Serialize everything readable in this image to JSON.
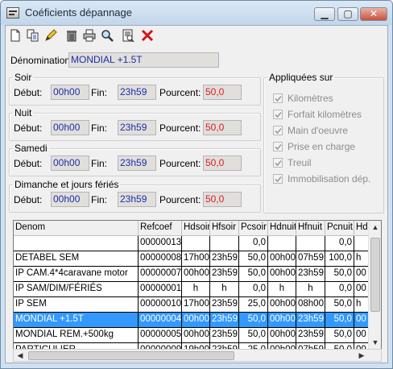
{
  "window": {
    "title": "Coéficients dépannage"
  },
  "toolbar": {
    "buttons": [
      {
        "icon": "new-icon"
      },
      {
        "icon": "copy-icon"
      },
      {
        "icon": "edit-icon"
      },
      {
        "icon": "delete-icon"
      },
      {
        "icon": "print-icon"
      },
      {
        "icon": "search-icon"
      },
      {
        "icon": "report-icon"
      },
      {
        "icon": "close-icon"
      }
    ]
  },
  "form": {
    "denomination_label": "Dénomination:",
    "denomination_value": "MONDIAL +1.5T",
    "debut_label": "Début:",
    "fin_label": "Fin:",
    "pourcent_label": "Pourcent:",
    "groups": [
      {
        "title": "Soir",
        "debut": "00h00",
        "fin": "23h59",
        "pourcent": "50,0"
      },
      {
        "title": "Nuit",
        "debut": "00h00",
        "fin": "23h59",
        "pourcent": "50,0"
      },
      {
        "title": "Samedi",
        "debut": "00h00",
        "fin": "23h59",
        "pourcent": "50,0"
      },
      {
        "title": "Dimanche et jours fériés",
        "debut": "00h00",
        "fin": "23h59",
        "pourcent": "50,0"
      }
    ],
    "appliquees": {
      "title": "Appliquées sur",
      "items": [
        {
          "label": "Kilomètres",
          "checked": true
        },
        {
          "label": "Forfait kilomètres",
          "checked": true
        },
        {
          "label": "Main d'oeuvre",
          "checked": true
        },
        {
          "label": "Prise en charge",
          "checked": true
        },
        {
          "label": "Treuil",
          "checked": true
        },
        {
          "label": "Immobilisation dép.",
          "checked": true
        }
      ]
    }
  },
  "grid": {
    "columns": [
      "Denom",
      "Refcoef",
      "Hdsoir",
      "Hfsoir",
      "Pcsoir",
      "Hdnuit",
      "Hfnuit",
      "Pcnuit",
      "Hd"
    ],
    "rows": [
      [
        "",
        "00000013",
        "",
        "",
        "0,0",
        "",
        "",
        "0,0",
        ""
      ],
      [
        "DETABEL SEM",
        "00000008",
        "17h00",
        "23h59",
        "50,0",
        "00h00",
        "07h59",
        "100,0",
        "h"
      ],
      [
        "IP  CAM.4*4caravane motor",
        "00000007",
        "00h00",
        "23h59",
        "50,0",
        "00h00",
        "23h59",
        "50,0",
        "00"
      ],
      [
        "IP SAM/DIM/FÉRIÉS",
        "00000001",
        "h",
        "h",
        "0,0",
        "h",
        "h",
        "0,0",
        "00"
      ],
      [
        "IP SEM",
        "00000010",
        "17h00",
        "23h59",
        "25,0",
        "00h00",
        "08h00",
        "50,0",
        "h"
      ],
      [
        "MONDIAL +1.5T",
        "00000004",
        "00h00",
        "23h59",
        "50,0",
        "00h00",
        "23h59",
        "50,0",
        "00"
      ],
      [
        "MONDIAL REM.+500kg",
        "00000005",
        "00h00",
        "23h59",
        "50,0",
        "00h00",
        "23h59",
        "50,0",
        "00"
      ],
      [
        "PARTICULIER",
        "00000009",
        "19h00",
        "23h59",
        "25,0",
        "00h00",
        "07h59",
        "50,0",
        "00"
      ]
    ],
    "selected_row": 5
  },
  "colors": {
    "selection": "#3399ff",
    "field_bg": "#e1dfdc",
    "time_text": "#1a2faa",
    "percent_text": "#d81f1f"
  }
}
